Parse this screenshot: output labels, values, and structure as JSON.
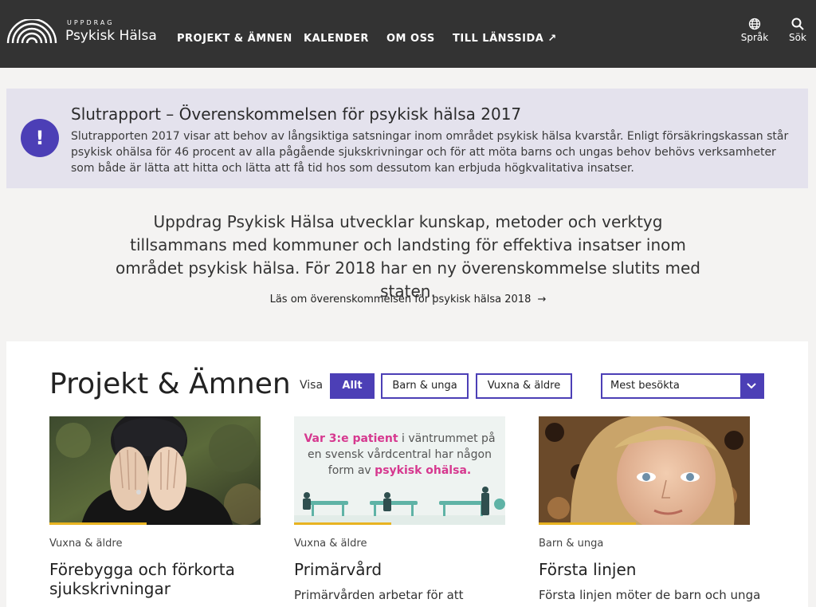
{
  "header": {
    "logo_small": "UPPDRAG",
    "logo_big": "Psykisk Hälsa",
    "nav": [
      "PROJEKT & ÄMNEN",
      "KALENDER",
      "OM OSS",
      "TILL LÄNSSIDA"
    ],
    "external_glyph": "↗",
    "language_label": "Språk",
    "search_label": "Sök"
  },
  "alert": {
    "icon_glyph": "!",
    "title": "Slutrapport – Överenskommelsen för psykisk hälsa 2017",
    "body": "Slutrapporten 2017 visar att behov av långsiktiga satsningar inom området psykisk hälsa kvarstår. Enligt försäkringskassan står psykisk ohälsa för 46 procent av alla pågående sjukskrivningar och för att möta barns och ungas behov behövs verksamheter som både är lätta att hitta och lätta att få tid hos som dessutom kan erbjuda högkvalitativa insatser."
  },
  "intro": {
    "text": "Uppdrag Psykisk Hälsa utvecklar kunskap, metoder och verktyg tillsammans med kommuner och landsting för effektiva insatser inom området psykisk hälsa. För 2018 har en ny överenskommelse slutits med staten.",
    "link": "Läs om överenskommelsen för psykisk hälsa 2018",
    "link_arrow": "→"
  },
  "projects": {
    "title": "Projekt & Ämnen",
    "filter_label": "Visa",
    "filters": [
      "Allt",
      "Barn & unga",
      "Vuxna & äldre"
    ],
    "active_filter": "Allt",
    "sort_value": "Mest besökta",
    "cards": [
      {
        "tag": "Vuxna & äldre",
        "title": "Förebygga och förkorta sjukskrivningar",
        "text": ""
      },
      {
        "tag": "Vuxna & äldre",
        "title": "Primärvård",
        "text": "Primärvården arbetar för att"
      },
      {
        "tag": "Barn & unga",
        "title": "Första linjen",
        "text": "Första linjen möter de barn och unga"
      }
    ],
    "poster": {
      "line1_highlight": "Var 3:e patient",
      "line1_rest": " i väntrummet på",
      "line2": "en svensk vårdcentral har någon",
      "line3_pre": "form av ",
      "line3_highlight": "psykisk ohälsa."
    }
  },
  "colors": {
    "header_bg": "#333333",
    "accent": "#4c3fb6",
    "alert_bg": "#e4e2ed",
    "highlight_pink": "#d6388f",
    "card_bar": "#e8b321"
  },
  "icons": [
    "logo-arcs-icon",
    "globe-icon",
    "search-icon",
    "alert-icon",
    "arrow-right-icon",
    "chevron-down-icon"
  ]
}
